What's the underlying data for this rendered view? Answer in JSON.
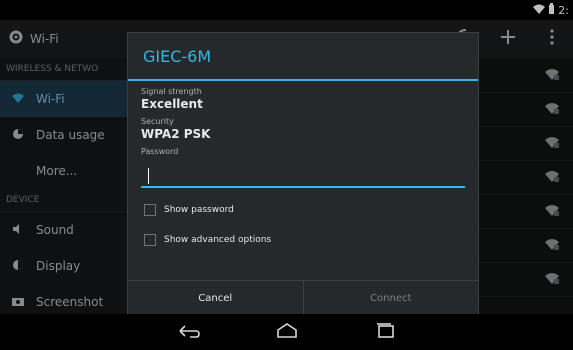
{
  "status": {
    "clock_partial": "2:"
  },
  "actionbar": {
    "title": "Wi-Fi"
  },
  "sidebar": {
    "section_wireless": "WIRELESS & NETWO",
    "section_device": "DEVICE",
    "items": [
      {
        "label": "Wi-Fi"
      },
      {
        "label": "Data usage"
      },
      {
        "label": "More..."
      },
      {
        "label": "Sound"
      },
      {
        "label": "Display"
      },
      {
        "label": "Screenshot"
      }
    ]
  },
  "dialog": {
    "title": "GIEC-6M",
    "signal_label": "Signal strength",
    "signal_value": "Excellent",
    "security_label": "Security",
    "security_value": "WPA2 PSK",
    "password_label": "Password",
    "password_value": "",
    "show_password_label": "Show password",
    "show_advanced_label": "Show advanced options",
    "cancel_label": "Cancel",
    "connect_label": "Connect"
  },
  "colors": {
    "accent": "#33b5e5"
  }
}
